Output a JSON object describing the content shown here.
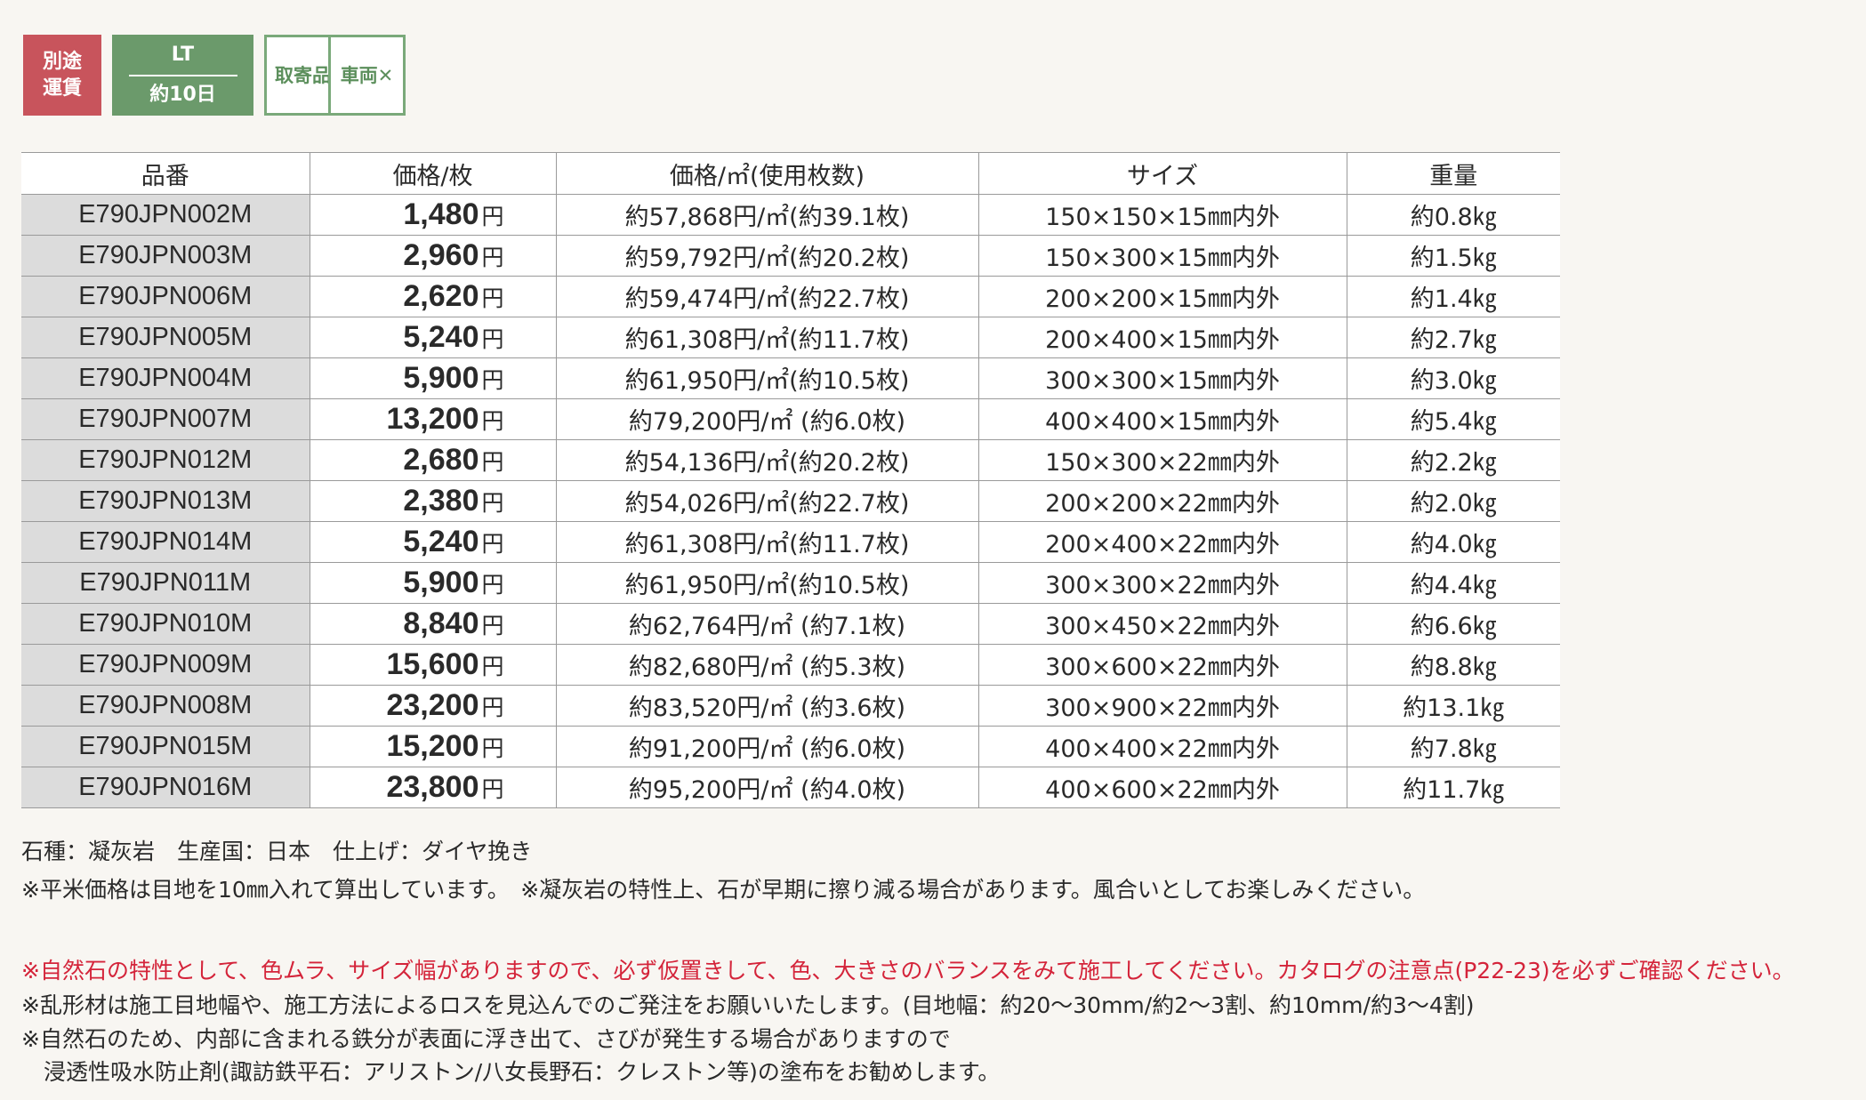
{
  "badges": {
    "freight": [
      "別途",
      "運賃"
    ],
    "lt_label": "LT",
    "lt_days": "約10日",
    "order": "取寄品",
    "vehicle": "車両✕"
  },
  "table": {
    "headers": [
      "品番",
      "価格/枚",
      "価格/㎡(使用枚数)",
      "サイズ",
      "重量"
    ],
    "price_unit": "円",
    "rows": [
      {
        "code": "E790JPN002M",
        "price": "1,480",
        "sqm": "約57,868円/㎡(約39.1枚)",
        "size": "150×150×15㎜内外",
        "weight": "約0.8㎏"
      },
      {
        "code": "E790JPN003M",
        "price": "2,960",
        "sqm": "約59,792円/㎡(約20.2枚)",
        "size": "150×300×15㎜内外",
        "weight": "約1.5㎏"
      },
      {
        "code": "E790JPN006M",
        "price": "2,620",
        "sqm": "約59,474円/㎡(約22.7枚)",
        "size": "200×200×15㎜内外",
        "weight": "約1.4㎏"
      },
      {
        "code": "E790JPN005M",
        "price": "5,240",
        "sqm": "約61,308円/㎡(約11.7枚)",
        "size": "200×400×15㎜内外",
        "weight": "約2.7㎏"
      },
      {
        "code": "E790JPN004M",
        "price": "5,900",
        "sqm": "約61,950円/㎡(約10.5枚)",
        "size": "300×300×15㎜内外",
        "weight": "約3.0㎏"
      },
      {
        "code": "E790JPN007M",
        "price": "13,200",
        "sqm": "約79,200円/㎡ (約6.0枚)",
        "size": "400×400×15㎜内外",
        "weight": "約5.4㎏"
      },
      {
        "code": "E790JPN012M",
        "price": "2,680",
        "sqm": "約54,136円/㎡(約20.2枚)",
        "size": "150×300×22㎜内外",
        "weight": "約2.2㎏"
      },
      {
        "code": "E790JPN013M",
        "price": "2,380",
        "sqm": "約54,026円/㎡(約22.7枚)",
        "size": "200×200×22㎜内外",
        "weight": "約2.0㎏"
      },
      {
        "code": "E790JPN014M",
        "price": "5,240",
        "sqm": "約61,308円/㎡(約11.7枚)",
        "size": "200×400×22㎜内外",
        "weight": "約4.0㎏"
      },
      {
        "code": "E790JPN011M",
        "price": "5,900",
        "sqm": "約61,950円/㎡(約10.5枚)",
        "size": "300×300×22㎜内外",
        "weight": "約4.4㎏"
      },
      {
        "code": "E790JPN010M",
        "price": "8,840",
        "sqm": "約62,764円/㎡ (約7.1枚)",
        "size": "300×450×22㎜内外",
        "weight": "約6.6㎏"
      },
      {
        "code": "E790JPN009M",
        "price": "15,600",
        "sqm": "約82,680円/㎡ (約5.3枚)",
        "size": "300×600×22㎜内外",
        "weight": "約8.8㎏"
      },
      {
        "code": "E790JPN008M",
        "price": "23,200",
        "sqm": "約83,520円/㎡ (約3.6枚)",
        "size": "300×900×22㎜内外",
        "weight": "約13.1㎏"
      },
      {
        "code": "E790JPN015M",
        "price": "15,200",
        "sqm": "約91,200円/㎡ (約6.0枚)",
        "size": "400×400×22㎜内外",
        "weight": "約7.8㎏"
      },
      {
        "code": "E790JPN016M",
        "price": "23,800",
        "sqm": "約95,200円/㎡ (約4.0枚)",
        "size": "400×600×22㎜内外",
        "weight": "約11.7㎏"
      }
    ]
  },
  "notes": {
    "spec": "石種：凝灰岩　生産国：日本　仕上げ：ダイヤ挽き",
    "calc": "※平米価格は目地を10㎜入れて算出しています。　※凝灰岩の特性上、石が早期に擦り減る場合があります。風合いとしてお楽しみください。",
    "warning_red": "※自然石の特性として、色ムラ、サイズ幅がありますので、必ず仮置きして、色、大きさのバランスをみて施工してください。カタログの注意点(P22-23)を必ずご確認ください。",
    "irregular": "※乱形材は施工目地幅や、施工方法によるロスを見込んでのご発注をお願いいたします。(目地幅：約20〜30mm/約2〜3割、約10mm/約3〜4割)",
    "iron_1": "※自然石のため、内部に含まれる鉄分が表面に浮き出て、さびが発生する場合がありますので",
    "iron_2": "　浸透性吸水防止剤(諏訪鉄平石：アリストン/八女長野石：クレストン等)の塗布をお勧めします。"
  }
}
